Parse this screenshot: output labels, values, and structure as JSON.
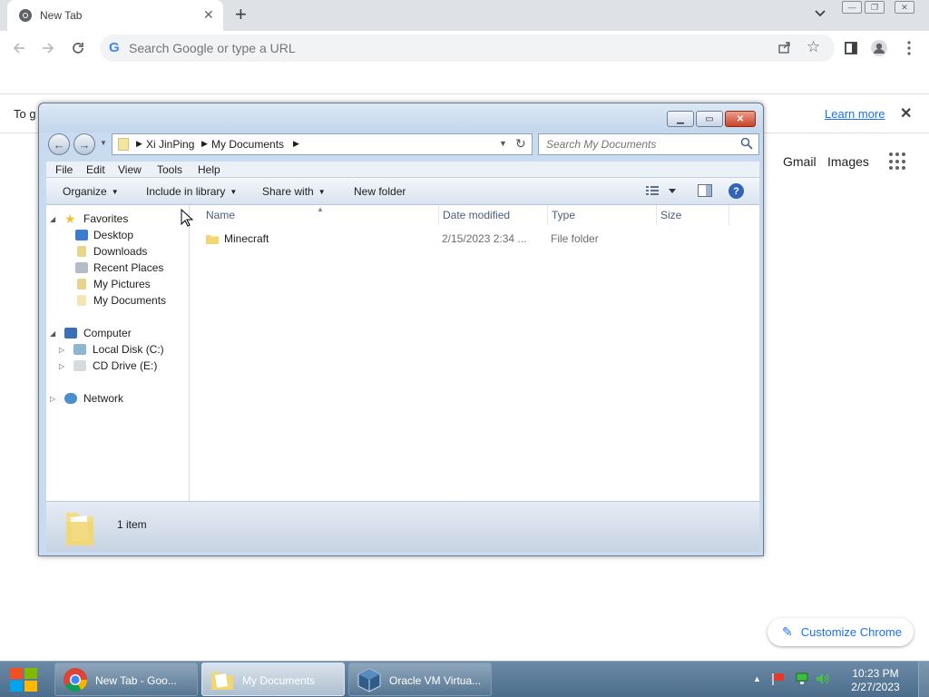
{
  "chrome": {
    "tab_title": "New Tab",
    "omnibox_placeholder": "Search Google or type a URL",
    "infobar_text": "To g",
    "infobar_link": "Learn more",
    "ntp_links": [
      "Gmail",
      "Images"
    ],
    "customize_label": "Customize Chrome"
  },
  "explorer": {
    "breadcrumb": [
      "Xi JinPing",
      "My Documents"
    ],
    "search_placeholder": "Search My Documents",
    "menu": [
      "File",
      "Edit",
      "View",
      "Tools",
      "Help"
    ],
    "commands": {
      "organize": "Organize",
      "include": "Include in library",
      "share": "Share with",
      "new_folder": "New folder"
    },
    "nav": {
      "favorites": "Favorites",
      "favorites_items": [
        "Desktop",
        "Downloads",
        "Recent Places",
        "My Pictures",
        "My Documents"
      ],
      "computer": "Computer",
      "computer_items": [
        "Local Disk (C:)",
        "CD Drive (E:)"
      ],
      "network": "Network"
    },
    "columns": [
      "Name",
      "Date modified",
      "Type",
      "Size"
    ],
    "files": [
      {
        "name": "Minecraft",
        "date": "2/15/2023 2:34 ...",
        "type": "File folder",
        "size": ""
      }
    ],
    "status": "1 item"
  },
  "taskbar": {
    "items": [
      "New Tab - Goo...",
      "My Documents",
      "Oracle VM Virtua..."
    ],
    "time": "10:23 PM",
    "date": "2/27/2023"
  },
  "colors": {
    "chrome_accent": "#1a73e8",
    "taskbar": "#5b7c9a",
    "explorer_frame": "#c8dbef"
  }
}
